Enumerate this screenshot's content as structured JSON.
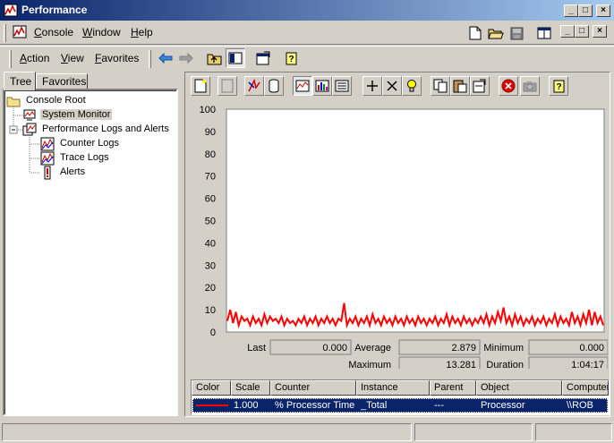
{
  "window": {
    "title": "Performance",
    "controls": {
      "minimize": "_",
      "maximize": "□",
      "close": "×"
    }
  },
  "menubar": {
    "items": [
      {
        "label": "Console",
        "key": "C"
      },
      {
        "label": "Window",
        "key": "W"
      },
      {
        "label": "Help",
        "key": "H"
      }
    ]
  },
  "actionbar": {
    "items": [
      {
        "label": "Action",
        "key": "A"
      },
      {
        "label": "View",
        "key": "V"
      },
      {
        "label": "Favorites",
        "key": "F"
      }
    ]
  },
  "tabs": {
    "tree": "Tree",
    "favorites": "Favorites"
  },
  "tree": {
    "root": "Console Root",
    "system_monitor": "System Monitor",
    "perf_logs": "Performance Logs and Alerts",
    "counter_logs": "Counter Logs",
    "trace_logs": "Trace Logs",
    "alerts": "Alerts"
  },
  "chart_data": {
    "type": "line",
    "title": "",
    "xlabel": "",
    "ylabel": "",
    "ylim": [
      0,
      100
    ],
    "yticks": [
      100,
      90,
      80,
      70,
      60,
      50,
      40,
      30,
      20,
      10,
      0
    ],
    "grid": false,
    "series": [
      {
        "name": "% Processor Time",
        "color": "#ff0000",
        "values": [
          5,
          10,
          4,
          9,
          3,
          7,
          5,
          6,
          3,
          7,
          4,
          6,
          3,
          8,
          4,
          7,
          5,
          6,
          4,
          7,
          3,
          6,
          4,
          5,
          3,
          6,
          4,
          7,
          3,
          6,
          4,
          7,
          3,
          6,
          4,
          7,
          4,
          6,
          3,
          6,
          5,
          13,
          3,
          6,
          4,
          7,
          3,
          6,
          4,
          7,
          3,
          8,
          4,
          6,
          3,
          7,
          4,
          6,
          3,
          7,
          4,
          6,
          3,
          7,
          4,
          6,
          3,
          7,
          4,
          6,
          3,
          6,
          4,
          7,
          3,
          6,
          4,
          8,
          3,
          7,
          4,
          6,
          3,
          7,
          4,
          6,
          3,
          6,
          4,
          7,
          4,
          8,
          3,
          7,
          4,
          9,
          5,
          11,
          4,
          7,
          3,
          8,
          4,
          7,
          3,
          6,
          4,
          7,
          3,
          6,
          4,
          7,
          3,
          6,
          4,
          8,
          3,
          7,
          4,
          6,
          3,
          9,
          4,
          7,
          3,
          8,
          4,
          10,
          3,
          9,
          4,
          7,
          3
        ]
      }
    ]
  },
  "stats": {
    "last_label": "Last",
    "last": "0.000",
    "average_label": "Average",
    "average": "2.879",
    "minimum_label": "Minimum",
    "minimum": "0.000",
    "maximum_label": "Maximum",
    "maximum": "13.281",
    "duration_label": "Duration",
    "duration": "1:04:17"
  },
  "legend": {
    "headers": [
      "Color",
      "Scale",
      "Counter",
      "Instance",
      "Parent",
      "Object",
      "Computer"
    ],
    "row": {
      "color": "#ff0000",
      "scale": "1.000",
      "counter": "% Processor Time",
      "instance": "_Total",
      "parent": "---",
      "object": "Processor",
      "computer": "\\\\ROB"
    }
  }
}
